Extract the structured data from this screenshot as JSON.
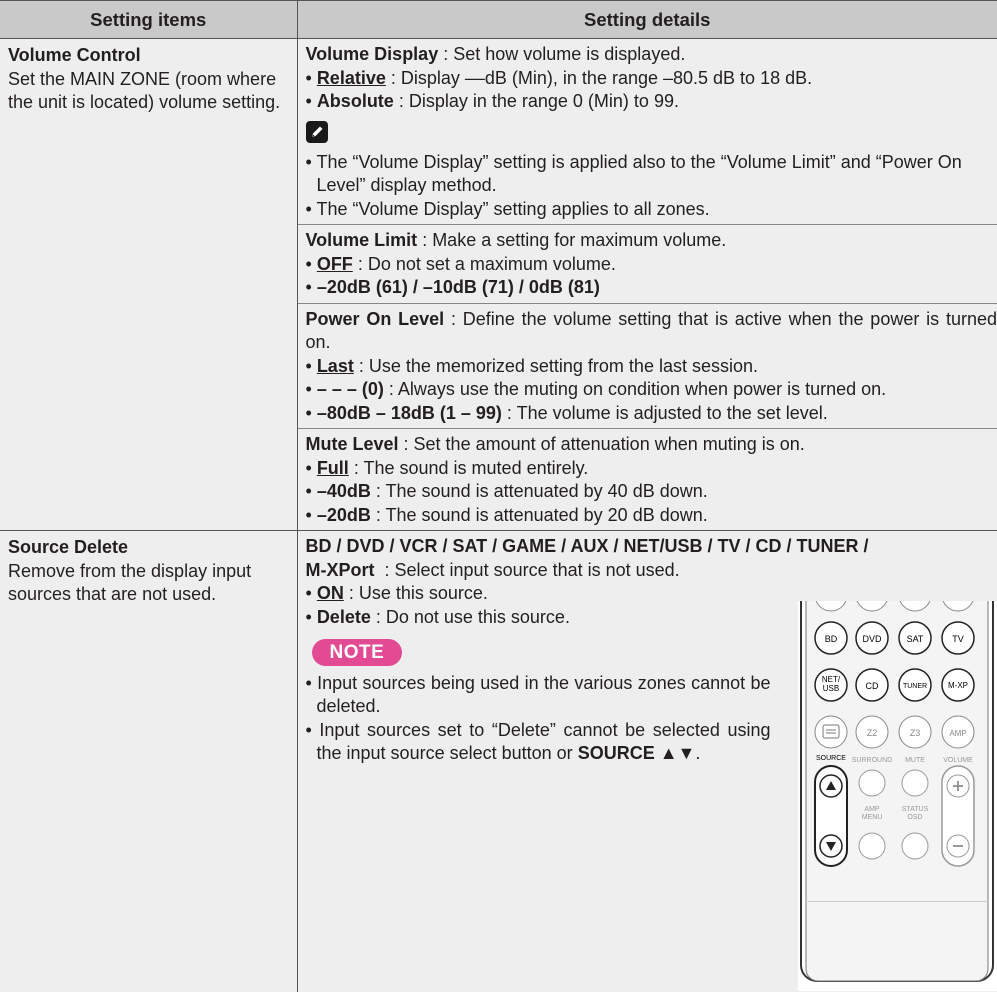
{
  "header": {
    "col1": "Setting items",
    "col2": "Setting details"
  },
  "volume_control": {
    "title": "Volume Control",
    "description": "Set the MAIN ZONE (room where the unit is located) volume setting.",
    "volume_display": {
      "label": "Volume Display",
      "text": " : Set how volume is displayed.",
      "relative_label": "Relative",
      "relative_text": " : Display ––dB (Min), in the range –80.5 dB to 18 dB.",
      "absolute_label": "Absolute",
      "absolute_text": " : Display in the range 0 (Min) to 99.",
      "note1": "The “Volume Display” setting is applied also to the “Volume Limit” and “Power On Level” display method.",
      "note2": "The “Volume Display” setting applies to all zones."
    },
    "volume_limit": {
      "label": "Volume Limit",
      "text": " : Make a setting for maximum volume.",
      "off_label": "OFF",
      "off_text": " : Do not set a maximum volume.",
      "options": "–20dB (61) / –10dB (71) / 0dB (81)"
    },
    "power_on_level": {
      "label": "Power On Level",
      "text": " : Define the volume setting that is active when the power is turned on.",
      "last_label": "Last",
      "last_text": " : Use the memorized setting from the last session.",
      "mute_label": "– – – (0)",
      "mute_text": " : Always use the muting on condition when power is turned on.",
      "range_label": "–80dB – 18dB (1 – 99)",
      "range_text": " : The volume is adjusted to the set level."
    },
    "mute_level": {
      "label": "Mute Level",
      "text": " : Set the amount of attenuation when muting is on.",
      "full_label": "Full",
      "full_text": " : The sound is muted entirely.",
      "m40_label": "–40dB",
      "m40_text": " : The sound is attenuated by 40 dB down.",
      "m20_label": "–20dB",
      "m20_text": " : The sound is attenuated by 20 dB down."
    }
  },
  "source_delete": {
    "title": "Source Delete",
    "description": "Remove from the display input sources that are not used.",
    "sources_line1": "BD / DVD / VCR / SAT / GAME / AUX / NET/USB / TV / CD / TUNER /",
    "sources_line2": "M-XPort",
    "sources_text": "  : Select input source that is not used.",
    "on_label": "ON",
    "on_text": " : Use this source.",
    "delete_label": "Delete",
    "delete_text": " : Do not use this source.",
    "note_label": "NOTE",
    "note1": "Input sources being used in the various zones cannot be deleted.",
    "note2": "Input sources set to “Delete” cannot be selected using the input source select button or",
    "note2_key": "SOURCE ▲▼",
    "note2_end": "."
  },
  "remote": {
    "row1": [
      "BD",
      "DVD",
      "SAT",
      "TV"
    ],
    "row2": [
      "NET/",
      "USB",
      "CD",
      "TUNER",
      "M-XP"
    ],
    "row3": [
      "Z2",
      "Z3",
      "AMP"
    ],
    "labels": [
      "SOURCE",
      "SURROUND",
      "MUTE",
      "VOLUME",
      "AMP",
      "MENU",
      "STATUS",
      "OSD"
    ]
  }
}
